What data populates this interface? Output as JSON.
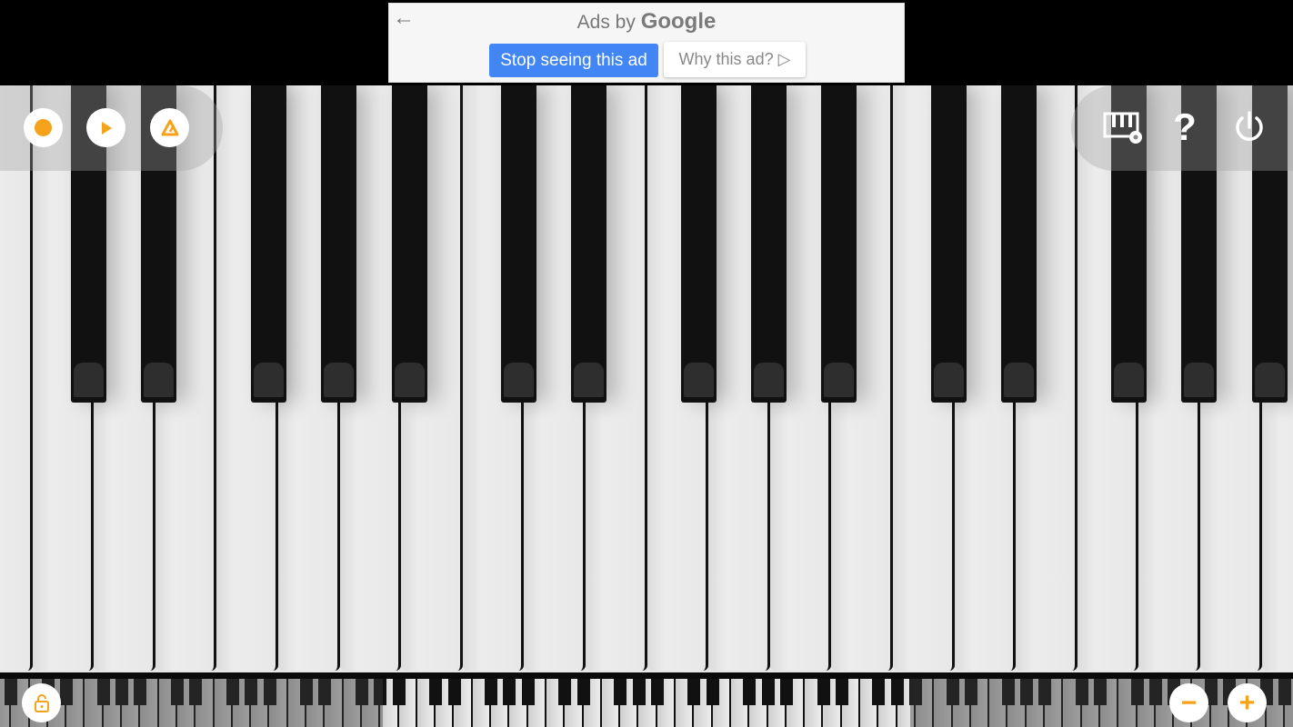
{
  "ad": {
    "back_icon": "arrow-left-icon",
    "title_prefix": "Ads by",
    "title_brand": "Google",
    "stop_label": "Stop seeing this ad",
    "why_label": "Why this ad?",
    "why_icon": "adchoices-icon"
  },
  "toolbar_left": [
    {
      "name": "record-button",
      "icon": "record-icon"
    },
    {
      "name": "play-button",
      "icon": "play-icon"
    },
    {
      "name": "metronome-button",
      "icon": "metronome-icon"
    }
  ],
  "toolbar_right": [
    {
      "name": "keyboard-settings-button",
      "icon": "keyboard-settings-icon"
    },
    {
      "name": "help-button",
      "icon": "help-icon",
      "glyph": "?"
    },
    {
      "name": "power-button",
      "icon": "power-icon"
    }
  ],
  "bottom_controls": {
    "lock_icon": "unlock-icon",
    "zoom_out_label": "−",
    "zoom_in_label": "+"
  },
  "colors": {
    "accent": "#f7a21b",
    "ad_button_blue": "#4285f4",
    "key_black": "#111111",
    "key_white": "#e8e8e8"
  },
  "keyboard": {
    "visible_white_keys": 22,
    "visible_black_keys": 15
  }
}
